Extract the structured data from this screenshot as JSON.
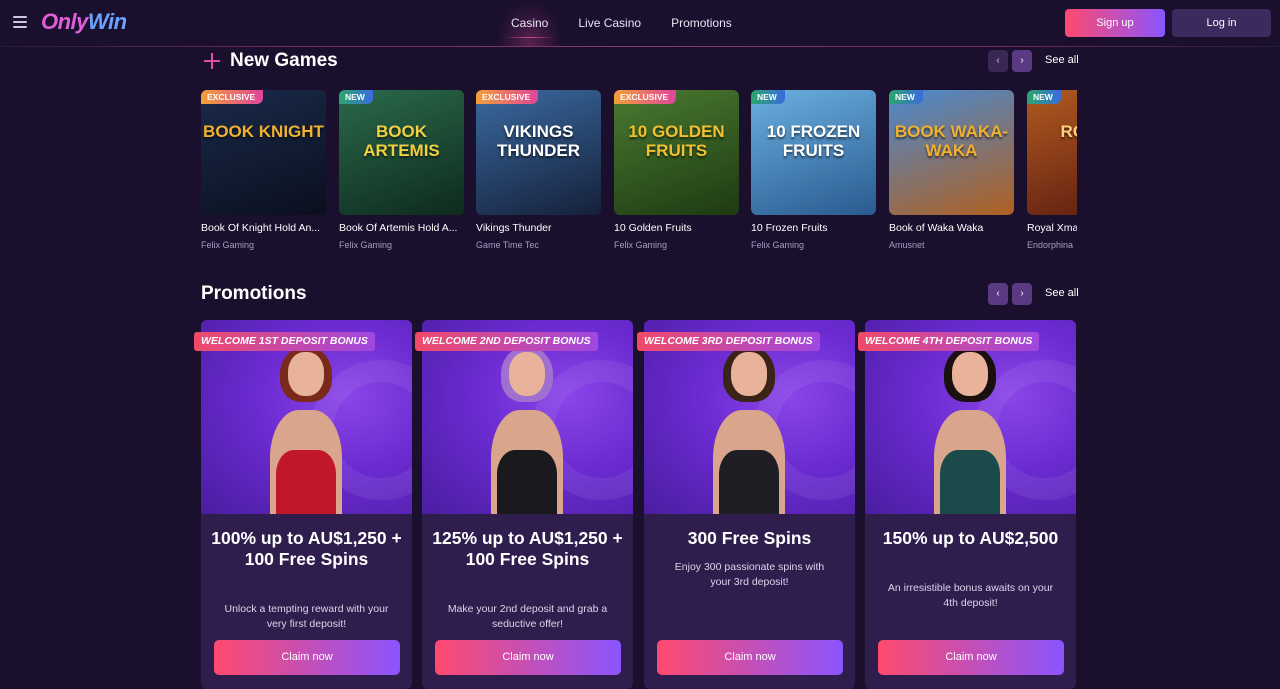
{
  "header": {
    "logo_part1": "Only",
    "logo_part2": "Win",
    "nav": [
      {
        "label": "Casino",
        "active": true
      },
      {
        "label": "Live Casino",
        "active": false
      },
      {
        "label": "Promotions",
        "active": false
      }
    ],
    "signup_label": "Sign up",
    "login_label": "Log in"
  },
  "new_games": {
    "title": "New Games",
    "see_all": "See all",
    "prev_arrow": "‹",
    "next_arrow": "›",
    "games": [
      {
        "badge": "EXCLUSIVE",
        "badge_type": "exclusive",
        "name": "Book Of Knight Hold An...",
        "provider": "Felix Gaming",
        "thumb_text": "BOOK KNIGHT",
        "color1": "#1a2a4a",
        "color2": "#0a0f1e",
        "text_color": "#f0b030"
      },
      {
        "badge": "NEW",
        "badge_type": "new",
        "name": "Book Of Artemis Hold A...",
        "provider": "Felix Gaming",
        "thumb_text": "BOOK ARTEMIS",
        "color1": "#2a6a4a",
        "color2": "#0e2a1e",
        "text_color": "#f0d040"
      },
      {
        "badge": "EXCLUSIVE",
        "badge_type": "exclusive",
        "name": "Vikings Thunder",
        "provider": "Game Time Tec",
        "thumb_text": "VIKINGS THUNDER",
        "color1": "#3a6aa0",
        "color2": "#15203a",
        "text_color": "#ffffff"
      },
      {
        "badge": "EXCLUSIVE",
        "badge_type": "exclusive",
        "name": "10 Golden Fruits",
        "provider": "Felix Gaming",
        "thumb_text": "10 GOLDEN FRUITS",
        "color1": "#4a7a30",
        "color2": "#1e3a12",
        "text_color": "#f0c030"
      },
      {
        "badge": "NEW",
        "badge_type": "new",
        "name": "10 Frozen Fruits",
        "provider": "Felix Gaming",
        "thumb_text": "10 FROZEN FRUITS",
        "color1": "#6ab0e0",
        "color2": "#2a5a90",
        "text_color": "#ffffff"
      },
      {
        "badge": "NEW",
        "badge_type": "new",
        "name": "Book of Waka Waka",
        "provider": "Amusnet",
        "thumb_text": "BOOK WAKA-WAKA",
        "color1": "#4a8ad0",
        "color2": "#b06020",
        "text_color": "#f0b030"
      },
      {
        "badge": "NEW",
        "badge_type": "new",
        "name": "Royal Xmas",
        "provider": "Endorphina",
        "thumb_text": "ROYAL",
        "color1": "#b05a20",
        "color2": "#5a1a10",
        "text_color": "#ffd080"
      }
    ]
  },
  "promotions": {
    "title": "Promotions",
    "see_all": "See all",
    "prev_arrow": "‹",
    "next_arrow": "›",
    "items": [
      {
        "label": "WELCOME 1ST DEPOSIT BONUS",
        "title": "100% up to AU$1,250 + 100 Free Spins",
        "desc": "Unlock a tempting reward with your very first deposit!",
        "cta": "Claim now",
        "hair": "#7a2a1a",
        "dress": "#c0182a"
      },
      {
        "label": "WELCOME 2ND DEPOSIT BONUS",
        "title": "125% up to AU$1,250 + 100 Free Spins",
        "desc": "Make your 2nd deposit and grab a seductive offer!",
        "cta": "Claim now",
        "hair": "#a070d0",
        "dress": "#1a1a1e"
      },
      {
        "label": "WELCOME 3RD DEPOSIT BONUS",
        "title": "300 Free Spins",
        "desc": "Enjoy 300 passionate spins with your 3rd deposit!",
        "cta": "Claim now",
        "hair": "#3a2418",
        "dress": "#1e1e24"
      },
      {
        "label": "WELCOME 4TH DEPOSIT BONUS",
        "title": "150% up to AU$2,500",
        "desc": "An irresistible bonus awaits on your 4th deposit!",
        "cta": "Claim now",
        "hair": "#1a1010",
        "dress": "#1a4a4a"
      }
    ]
  },
  "colors": {
    "background": "#1b0f2e",
    "accent_pink": "#ff4a6e",
    "accent_purple": "#8a55ff",
    "card_bg": "#2e1d4d"
  }
}
